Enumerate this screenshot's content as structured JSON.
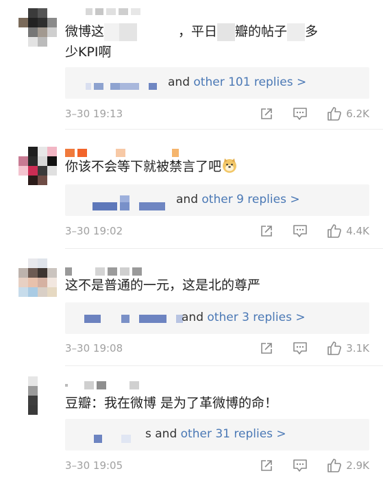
{
  "colors": {
    "link": "#4a78b5",
    "muted": "#a0a0a0",
    "bar": "#f5f5f5"
  },
  "comments": [
    {
      "text_a": "微博这",
      "text_b": "，平日",
      "text_c": "瓣的帖子",
      "text_d": "多",
      "text_line2": "少KPI啊",
      "replies_prefix": "and ",
      "replies_link": "other 101 replies >",
      "time": "3–30 19:13",
      "likes": "6.2K"
    },
    {
      "text": "你该不会等下就被禁言了吧",
      "emoji": "doge-emoji",
      "replies_prefix": "and ",
      "replies_link": "other 9 replies >",
      "time": "3–30 19:02",
      "likes": "4.4K"
    },
    {
      "text": "这不是普通的一元，这是北的尊严",
      "replies_prefix": "and ",
      "replies_link": "other 3 replies >",
      "time": "3–30 19:08",
      "likes": "3.1K"
    },
    {
      "text": "豆瓣：我在微博 是为了革微博的命！",
      "replies_prefix": "s and ",
      "replies_link": "other 31 replies >",
      "time": "3–30 19:05",
      "likes": "2.9K"
    }
  ],
  "icons": {
    "share": "share-icon",
    "comment": "comment-icon",
    "like": "thumbs-up-icon"
  }
}
